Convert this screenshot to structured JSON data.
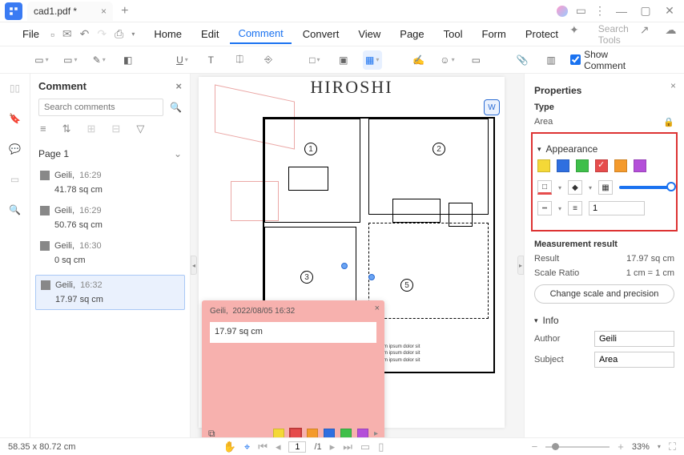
{
  "titlebar": {
    "filename": "cad1.pdf *"
  },
  "menu": {
    "file": "File",
    "items": [
      "Home",
      "Edit",
      "Comment",
      "Convert",
      "View",
      "Page",
      "Tool",
      "Form",
      "Protect"
    ],
    "active": "Comment",
    "search_placeholder": "Search Tools"
  },
  "toolbar": {
    "show_comment": "Show Comment"
  },
  "comment_panel": {
    "title": "Comment",
    "search_placeholder": "Search comments",
    "page_label": "Page 1",
    "items": [
      {
        "author": "Geili,",
        "time": "16:29",
        "value": "41.78 sq cm"
      },
      {
        "author": "Geili,",
        "time": "16:29",
        "value": "50.76 sq cm"
      },
      {
        "author": "Geili,",
        "time": "16:30",
        "value": "0 sq cm"
      },
      {
        "author": "Geili,",
        "time": "16:32",
        "value": "17.97 sq cm"
      }
    ]
  },
  "canvas": {
    "doc_title": "HIROSHI",
    "popup": {
      "author": "Geili,",
      "date": "2022/08/05 16:32",
      "value": "17.97 sq cm"
    }
  },
  "properties": {
    "title": "Properties",
    "type_label": "Type",
    "type_value": "Area",
    "appearance_label": "Appearance",
    "opacity_value": "1",
    "measure_label": "Measurement result",
    "result_label": "Result",
    "result_value": "17.97 sq cm",
    "scale_label": "Scale Ratio",
    "scale_value": "1 cm = 1 cm",
    "change_btn": "Change scale and precision",
    "info_label": "Info",
    "author_label": "Author",
    "author_value": "Geili",
    "subject_label": "Subject",
    "subject_value": "Area",
    "colors": [
      "#f4d837",
      "#2f6fe0",
      "#3fbf4a",
      "#e64c4c",
      "#f49a2c",
      "#b44fd9"
    ],
    "selected_color_index": 3
  },
  "statusbar": {
    "coords": "58.35 x 80.72 cm",
    "page_cur": "1",
    "page_total": "/1",
    "zoom": "33%"
  }
}
